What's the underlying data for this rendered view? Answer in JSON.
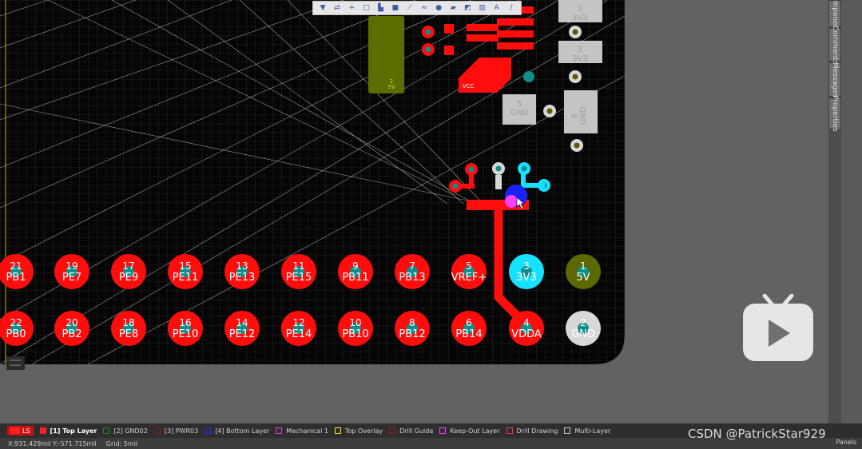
{
  "toolbar": {
    "tools": [
      {
        "name": "filter-icon",
        "glyph": "▼"
      },
      {
        "name": "route-icon",
        "glyph": "⇄"
      },
      {
        "name": "crosshair-icon",
        "glyph": "+"
      },
      {
        "name": "select-rect-icon",
        "glyph": "□"
      },
      {
        "name": "align-icon",
        "glyph": "▙"
      },
      {
        "name": "component-icon",
        "glyph": "■"
      },
      {
        "name": "interactive-route-icon",
        "glyph": "⟋"
      },
      {
        "name": "diff-pair-icon",
        "glyph": "≈"
      },
      {
        "name": "via-icon",
        "glyph": "●"
      },
      {
        "name": "polygon-icon",
        "glyph": "▰"
      },
      {
        "name": "keepout-icon",
        "glyph": "◩"
      },
      {
        "name": "dimension-icon",
        "glyph": "▥"
      },
      {
        "name": "text-icon",
        "glyph": "A"
      },
      {
        "name": "line-icon",
        "glyph": "/"
      }
    ]
  },
  "right_panels": [
    {
      "label": "Components"
    },
    {
      "label": "Comments"
    },
    {
      "label": "Messages"
    },
    {
      "label": "Properties"
    }
  ],
  "header_pads": [
    {
      "num": "21",
      "net": "PB1",
      "color": "#ff0d0d"
    },
    {
      "num": "19",
      "net": "PE7",
      "color": "#ff0d0d"
    },
    {
      "num": "17",
      "net": "PE9",
      "color": "#ff0d0d"
    },
    {
      "num": "15",
      "net": "PE11",
      "color": "#ff0d0d"
    },
    {
      "num": "13",
      "net": "PE13",
      "color": "#ff0d0d"
    },
    {
      "num": "11",
      "net": "PE15",
      "color": "#ff0d0d"
    },
    {
      "num": "9",
      "net": "PB11",
      "color": "#ff0d0d"
    },
    {
      "num": "7",
      "net": "PB13",
      "color": "#ff0d0d"
    },
    {
      "num": "5",
      "net": "VREF+",
      "color": "#ff0d0d"
    },
    {
      "num": "3",
      "net": "3V3",
      "color": "#18e0ff"
    },
    {
      "num": "1",
      "net": "5V",
      "color": "#5e6800"
    },
    {
      "num": "22",
      "net": "PB0",
      "color": "#ff0d0d"
    },
    {
      "num": "20",
      "net": "PB2",
      "color": "#ff0d0d"
    },
    {
      "num": "18",
      "net": "PE8",
      "color": "#ff0d0d"
    },
    {
      "num": "16",
      "net": "PE10",
      "color": "#ff0d0d"
    },
    {
      "num": "14",
      "net": "PE12",
      "color": "#ff0d0d"
    },
    {
      "num": "12",
      "net": "PE14",
      "color": "#ff0d0d"
    },
    {
      "num": "10",
      "net": "PB10",
      "color": "#ff0d0d"
    },
    {
      "num": "8",
      "net": "PB12",
      "color": "#ff0d0d"
    },
    {
      "num": "6",
      "net": "PB14",
      "color": "#ff0d0d"
    },
    {
      "num": "4",
      "net": "VDDA",
      "color": "#ff0d0d"
    },
    {
      "num": "2",
      "net": "GND",
      "color": "#d8d8d8"
    }
  ],
  "grey_pads": [
    {
      "num": "5",
      "net": "GND"
    },
    {
      "num": "6",
      "net": "GND"
    },
    {
      "num": "3",
      "net": "3V3"
    },
    {
      "num": "3",
      "net": "3V3"
    }
  ],
  "board_labels": {
    "cap_num": "2",
    "cap_net": "5V",
    "vcc": "VCC"
  },
  "layers": {
    "ls_label": "LS",
    "items": [
      {
        "label": "[1] Top Layer",
        "color": "#ff2020",
        "active": true
      },
      {
        "label": "[2] GND02",
        "color": "#1f8a2a",
        "active": false
      },
      {
        "label": "[3] PWR03",
        "color": "#8b1a1a",
        "active": false
      },
      {
        "label": "[4] Bottom Layer",
        "color": "#2030ff",
        "active": false
      },
      {
        "label": "Mechanical 1",
        "color": "#e040e0",
        "active": false
      },
      {
        "label": "Top Overlay",
        "color": "#ffe020",
        "active": false
      },
      {
        "label": "Drill Guide",
        "color": "#9a1a1a",
        "active": false
      },
      {
        "label": "Keep-Out Layer",
        "color": "#ff40ff",
        "active": false
      },
      {
        "label": "Drill Drawing",
        "color": "#ff3040",
        "active": false
      },
      {
        "label": "Multi-Layer",
        "color": "#c8c8c8",
        "active": false
      }
    ]
  },
  "status": {
    "coords": "X:931.429mil Y:-571.715mil",
    "grid": "Grid: 5mil",
    "panels": "Panels"
  },
  "watermark": "CSDN @PatrickStar929",
  "colors": {
    "board": "#050505",
    "copper": "#ff0d0d",
    "selected": "#18e0ff",
    "grid": "#3a3a3a",
    "ratsnest": "#bdbdbd"
  }
}
